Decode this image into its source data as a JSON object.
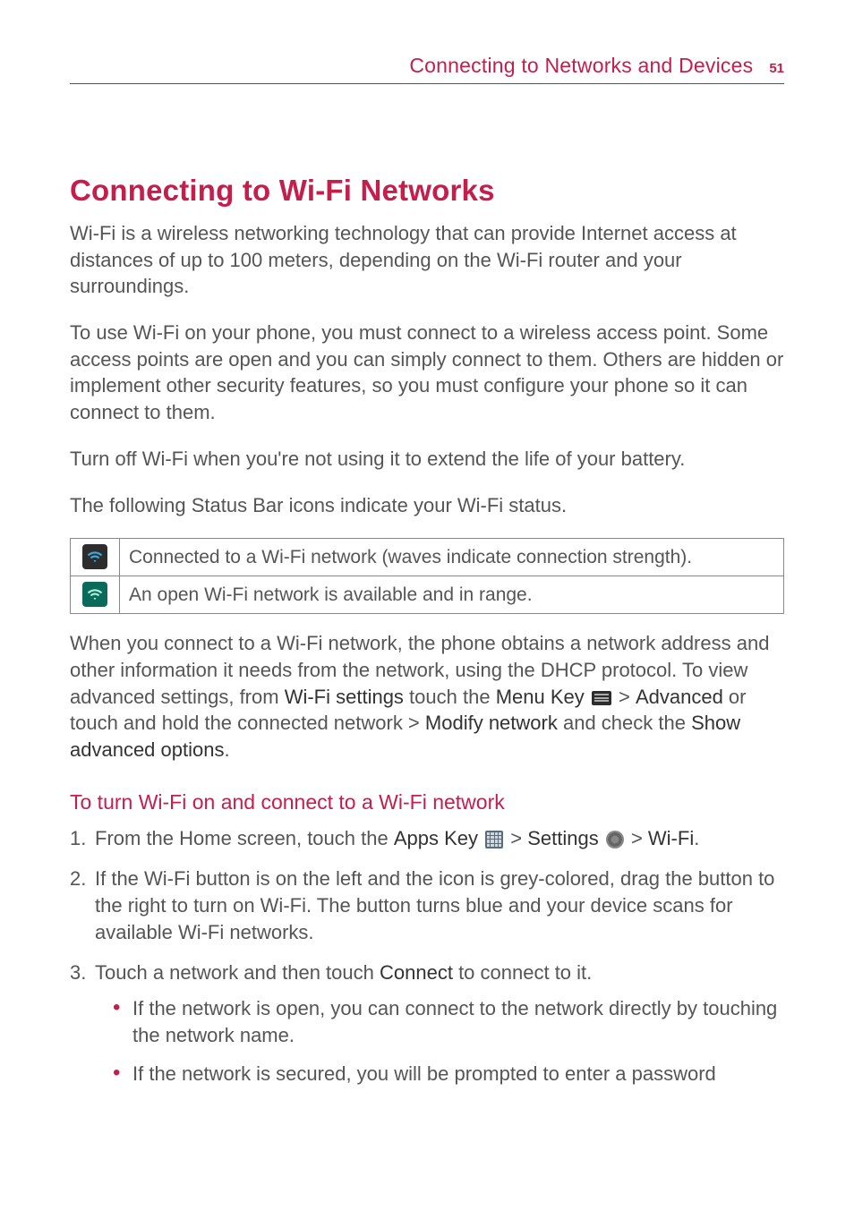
{
  "header": {
    "title": "Connecting to Networks and Devices",
    "page_number": "51"
  },
  "main_heading": "Connecting to Wi-Fi Networks",
  "intro_p1": "Wi-Fi is a wireless networking technology that can provide Internet access at distances of up to 100 meters, depending on the Wi-Fi router and your surroundings.",
  "intro_p2": "To use Wi-Fi on your phone, you must connect to a wireless access point. Some access points are open and you can simply connect to them. Others are hidden or implement other security features, so you must configure your phone so it can connect to them.",
  "intro_p3": "Turn off Wi-Fi when you're not using it to extend the life of your battery.",
  "intro_p4": "The following Status Bar icons indicate your Wi-Fi status.",
  "table": {
    "row1": "Connected to a Wi-Fi network (waves indicate connection strength).",
    "row2": "An open Wi-Fi network is available and in range."
  },
  "after_table": {
    "pre": "When you connect to a Wi-Fi network, the phone obtains a network address and other information it needs from the network, using the DHCP protocol. To view advanced settings, from ",
    "wifi_settings": "Wi-Fi settings",
    "touch_the": " touch the ",
    "menu_key": "Menu Key",
    "advanced": "Advanced",
    "or_touch": " or touch and hold the connected network > ",
    "modify_network": "Modify network",
    "check_the": " and check the ",
    "show_adv": "Show advanced options",
    "period": "."
  },
  "sub_heading": "To turn Wi-Fi on and connect to a Wi-Fi network",
  "steps": {
    "s1": {
      "pre": "From the Home screen, touch the ",
      "apps_key": "Apps Key",
      "settings": "Settings",
      "wifi": "Wi-Fi",
      "gt1": " > ",
      "gt2": " > ",
      "period": "."
    },
    "s2": "If the Wi-Fi button is on the left and the icon is grey-colored, drag the button to the right to turn on Wi-Fi. The button turns blue and your device scans for available Wi-Fi networks.",
    "s3": {
      "pre": "Touch a network and then touch ",
      "connect": "Connect",
      "post": " to connect to it.",
      "b1": "If the network is open, you can connect to the network directly by touching the network name.",
      "b2": "If the network is secured, you will be prompted to enter a password"
    }
  }
}
